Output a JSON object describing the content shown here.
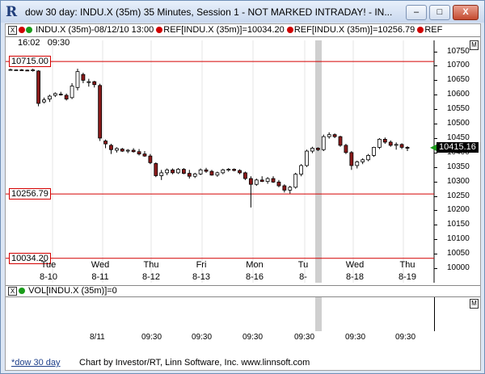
{
  "window": {
    "title": "dow 30 day: INDU.X (35m) 35 Minutes, Session 1 - NOT MARKED INTRADAY! - IN...",
    "app_icon": "R",
    "minimize": "–",
    "maximize": "□",
    "close": "X"
  },
  "info": {
    "close_box": "X",
    "series_label": "INDU.X (35m)-08/12/10 13:00",
    "ref1": "REF[INDU.X (35m)]=10034.20",
    "ref2": "REF[INDU.X (35m)]=10256.79",
    "ref3": "REF",
    "clock_time": "16:02",
    "clock_open": "09:30",
    "m_box": "M"
  },
  "price_axis": [
    "10750",
    "10700",
    "10650",
    "10600",
    "10550",
    "10500",
    "10450",
    "10400",
    "10350",
    "10300",
    "10250",
    "10200",
    "10150",
    "10100",
    "10050",
    "10000"
  ],
  "levels": [
    {
      "label": "10715.00",
      "value": 10715.0
    },
    {
      "label": "10256.79",
      "value": 10256.79
    },
    {
      "label": "10034.20",
      "value": 10034.2
    }
  ],
  "current_price": "10415.16",
  "days": [
    {
      "dow": "Tue",
      "date": "8-10"
    },
    {
      "dow": "Wed",
      "date": "8-11"
    },
    {
      "dow": "Thu",
      "date": "8-12"
    },
    {
      "dow": "Fri",
      "date": "8-13"
    },
    {
      "dow": "Mon",
      "date": "8-16"
    },
    {
      "dow": "Tu",
      "date": "8-"
    },
    {
      "dow": "Wed",
      "date": "8-18"
    },
    {
      "dow": "Thu",
      "date": "8-19"
    }
  ],
  "volume": {
    "close_box": "X",
    "label": "VOL[INDU.X (35m)]=0",
    "m_box": "M",
    "ticks": [
      "8/11",
      "09:30",
      "09:30",
      "09:30",
      "09:30",
      "09:30",
      "09:30"
    ]
  },
  "footer": {
    "tab": "*dow 30 day",
    "credit": "Chart by Investor/RT, Linn Software, Inc. www.linnsoft.com"
  },
  "colors": {
    "up": "#ffffff",
    "down": "#8b1a1a",
    "level_line": "#d40000",
    "highlight": "#cfcfcf"
  },
  "chart_data": {
    "type": "candlestick",
    "ylim": [
      10000,
      10760
    ],
    "candles": [
      {
        "o": 10686,
        "h": 10690,
        "l": 10683,
        "c": 10687
      },
      {
        "o": 10685,
        "h": 10688,
        "l": 10683,
        "c": 10686
      },
      {
        "o": 10686,
        "h": 10689,
        "l": 10684,
        "c": 10685
      },
      {
        "o": 10685,
        "h": 10687,
        "l": 10683,
        "c": 10684
      },
      {
        "o": 10684,
        "h": 10690,
        "l": 10680,
        "c": 10686
      },
      {
        "o": 10682,
        "h": 10685,
        "l": 10560,
        "c": 10570
      },
      {
        "o": 10575,
        "h": 10590,
        "l": 10570,
        "c": 10582
      },
      {
        "o": 10585,
        "h": 10600,
        "l": 10575,
        "c": 10595
      },
      {
        "o": 10598,
        "h": 10608,
        "l": 10592,
        "c": 10604
      },
      {
        "o": 10602,
        "h": 10610,
        "l": 10597,
        "c": 10600
      },
      {
        "o": 10598,
        "h": 10604,
        "l": 10580,
        "c": 10585
      },
      {
        "o": 10590,
        "h": 10640,
        "l": 10585,
        "c": 10630
      },
      {
        "o": 10625,
        "h": 10690,
        "l": 10615,
        "c": 10680
      },
      {
        "o": 10670,
        "h": 10676,
        "l": 10640,
        "c": 10650
      },
      {
        "o": 10645,
        "h": 10655,
        "l": 10628,
        "c": 10645
      },
      {
        "o": 10645,
        "h": 10648,
        "l": 10625,
        "c": 10635
      },
      {
        "o": 10632,
        "h": 10638,
        "l": 10440,
        "c": 10450
      },
      {
        "o": 10440,
        "h": 10445,
        "l": 10415,
        "c": 10430
      },
      {
        "o": 10425,
        "h": 10430,
        "l": 10395,
        "c": 10410
      },
      {
        "o": 10408,
        "h": 10418,
        "l": 10400,
        "c": 10414
      },
      {
        "o": 10412,
        "h": 10416,
        "l": 10402,
        "c": 10405
      },
      {
        "o": 10405,
        "h": 10412,
        "l": 10398,
        "c": 10408
      },
      {
        "o": 10408,
        "h": 10415,
        "l": 10400,
        "c": 10403
      },
      {
        "o": 10403,
        "h": 10412,
        "l": 10390,
        "c": 10395
      },
      {
        "o": 10395,
        "h": 10405,
        "l": 10385,
        "c": 10388
      },
      {
        "o": 10388,
        "h": 10395,
        "l": 10360,
        "c": 10365
      },
      {
        "o": 10362,
        "h": 10366,
        "l": 10315,
        "c": 10320
      },
      {
        "o": 10320,
        "h": 10340,
        "l": 10305,
        "c": 10330
      },
      {
        "o": 10330,
        "h": 10345,
        "l": 10322,
        "c": 10340
      },
      {
        "o": 10340,
        "h": 10345,
        "l": 10325,
        "c": 10330
      },
      {
        "o": 10330,
        "h": 10346,
        "l": 10326,
        "c": 10342
      },
      {
        "o": 10342,
        "h": 10346,
        "l": 10325,
        "c": 10328
      },
      {
        "o": 10328,
        "h": 10340,
        "l": 10310,
        "c": 10318
      },
      {
        "o": 10318,
        "h": 10330,
        "l": 10312,
        "c": 10326
      },
      {
        "o": 10326,
        "h": 10345,
        "l": 10322,
        "c": 10340
      },
      {
        "o": 10340,
        "h": 10347,
        "l": 10330,
        "c": 10335
      },
      {
        "o": 10335,
        "h": 10340,
        "l": 10320,
        "c": 10322
      },
      {
        "o": 10322,
        "h": 10334,
        "l": 10316,
        "c": 10330
      },
      {
        "o": 10330,
        "h": 10344,
        "l": 10325,
        "c": 10340
      },
      {
        "o": 10340,
        "h": 10346,
        "l": 10334,
        "c": 10342
      },
      {
        "o": 10342,
        "h": 10345,
        "l": 10335,
        "c": 10338
      },
      {
        "o": 10338,
        "h": 10342,
        "l": 10325,
        "c": 10330
      },
      {
        "o": 10330,
        "h": 10334,
        "l": 10305,
        "c": 10310
      },
      {
        "o": 10310,
        "h": 10318,
        "l": 10210,
        "c": 10290
      },
      {
        "o": 10290,
        "h": 10310,
        "l": 10285,
        "c": 10305
      },
      {
        "o": 10305,
        "h": 10318,
        "l": 10298,
        "c": 10300
      },
      {
        "o": 10300,
        "h": 10315,
        "l": 10292,
        "c": 10310
      },
      {
        "o": 10310,
        "h": 10318,
        "l": 10295,
        "c": 10298
      },
      {
        "o": 10298,
        "h": 10305,
        "l": 10280,
        "c": 10285
      },
      {
        "o": 10285,
        "h": 10290,
        "l": 10262,
        "c": 10270
      },
      {
        "o": 10270,
        "h": 10285,
        "l": 10258,
        "c": 10280
      },
      {
        "o": 10280,
        "h": 10330,
        "l": 10275,
        "c": 10325
      },
      {
        "o": 10325,
        "h": 10360,
        "l": 10318,
        "c": 10355
      },
      {
        "o": 10355,
        "h": 10410,
        "l": 10350,
        "c": 10405
      },
      {
        "o": 10405,
        "h": 10420,
        "l": 10398,
        "c": 10415
      },
      {
        "o": 10415,
        "h": 10418,
        "l": 10405,
        "c": 10410
      },
      {
        "o": 10410,
        "h": 10462,
        "l": 10405,
        "c": 10455
      },
      {
        "o": 10455,
        "h": 10470,
        "l": 10448,
        "c": 10462
      },
      {
        "o": 10462,
        "h": 10466,
        "l": 10450,
        "c": 10455
      },
      {
        "o": 10455,
        "h": 10458,
        "l": 10420,
        "c": 10425
      },
      {
        "o": 10425,
        "h": 10430,
        "l": 10395,
        "c": 10400
      },
      {
        "o": 10400,
        "h": 10405,
        "l": 10340,
        "c": 10355
      },
      {
        "o": 10355,
        "h": 10372,
        "l": 10345,
        "c": 10368
      },
      {
        "o": 10368,
        "h": 10380,
        "l": 10360,
        "c": 10375
      },
      {
        "o": 10375,
        "h": 10395,
        "l": 10370,
        "c": 10390
      },
      {
        "o": 10390,
        "h": 10420,
        "l": 10385,
        "c": 10418
      },
      {
        "o": 10418,
        "h": 10450,
        "l": 10412,
        "c": 10446
      },
      {
        "o": 10446,
        "h": 10452,
        "l": 10430,
        "c": 10436
      },
      {
        "o": 10436,
        "h": 10442,
        "l": 10420,
        "c": 10425
      },
      {
        "o": 10425,
        "h": 10435,
        "l": 10410,
        "c": 10428
      },
      {
        "o": 10428,
        "h": 10432,
        "l": 10412,
        "c": 10418
      },
      {
        "o": 10418,
        "h": 10422,
        "l": 10405,
        "c": 10415
      }
    ]
  }
}
